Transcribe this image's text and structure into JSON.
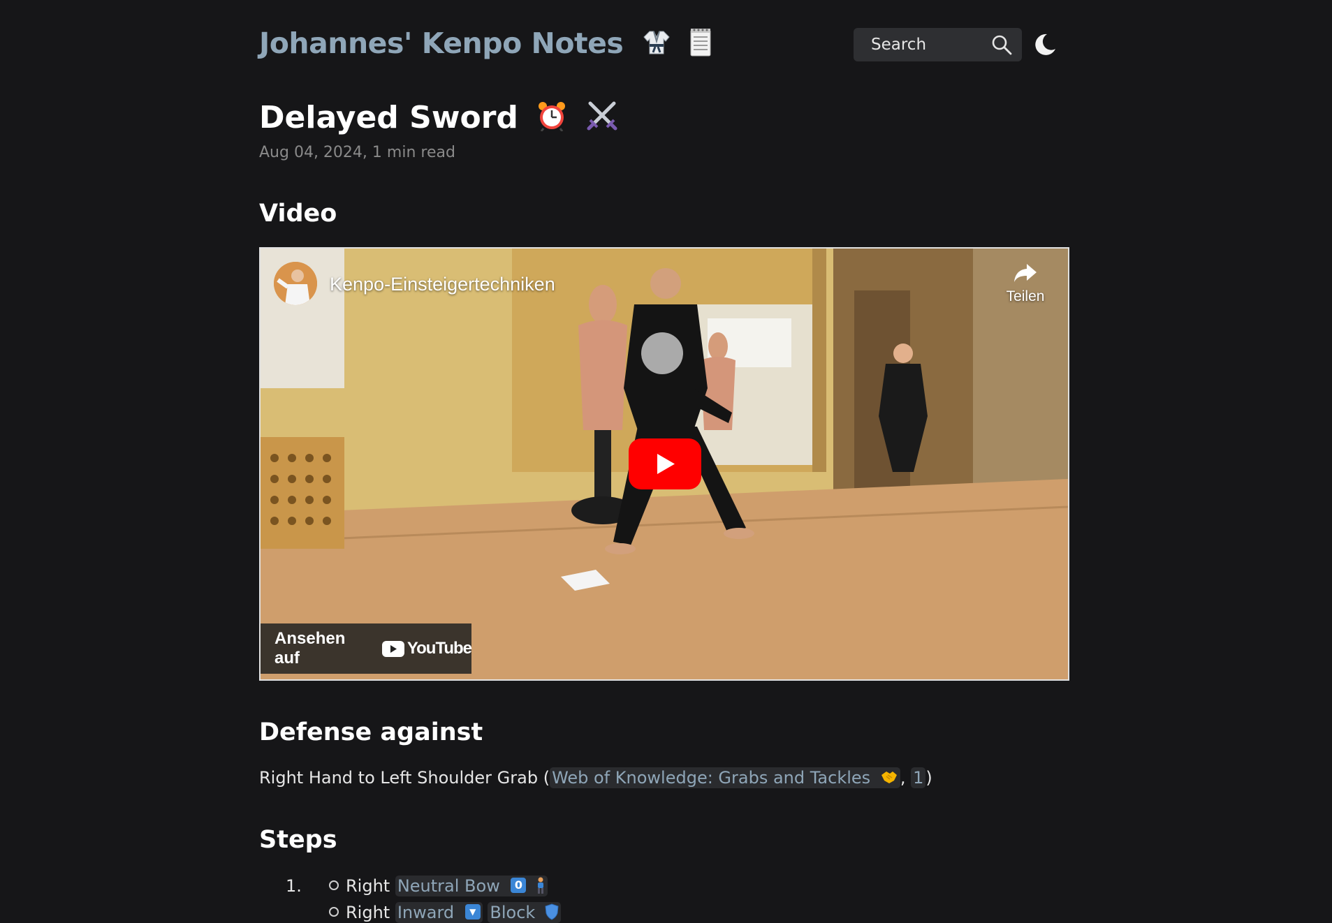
{
  "header": {
    "site_title": "Johannes' Kenpo Notes",
    "search_label": "Search",
    "icons": [
      "gi-icon",
      "notepad-icon",
      "search-icon",
      "moon-icon"
    ]
  },
  "article": {
    "title": "Delayed Sword",
    "meta": "Aug 04, 2024, 1 min read",
    "title_icons": [
      "alarm-clock-icon",
      "crossed-swords-icon"
    ]
  },
  "sections": {
    "video": "Video",
    "defense": "Defense against",
    "steps": "Steps"
  },
  "video": {
    "title": "Kenpo-Einsteigertechniken",
    "share_label": "Teilen",
    "watch_on_label": "Ansehen auf",
    "youtube_label": "YouTube"
  },
  "defense": {
    "text_before": "Right Hand to Left Shoulder Grab (",
    "link1": "Web of Knowledge: Grabs and Tackles",
    "separator": ", ",
    "link2": "1",
    "text_after": ")"
  },
  "steps": [
    {
      "number": "1.",
      "items": [
        {
          "prefix": "Right ",
          "links": [
            {
              "label": "Neutral Bow",
              "keycap": "0"
            }
          ]
        },
        {
          "prefix": "Right ",
          "links": [
            {
              "label": "Inward",
              "keycap": "▼"
            },
            {
              "label": "Block"
            }
          ]
        }
      ]
    }
  ],
  "colors": {
    "background": "#161618",
    "link": "#8fa6b8",
    "youtube_red": "#ff0000"
  }
}
